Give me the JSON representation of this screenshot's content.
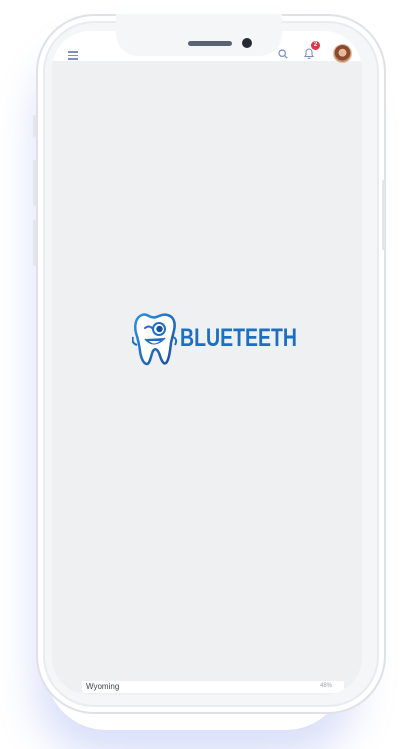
{
  "header": {
    "notification_count": "2"
  },
  "brand": {
    "name": "BLUETEETH",
    "color": "#1f6fc1"
  },
  "bottom_row": {
    "state": "Wyoming",
    "percent": "48%"
  },
  "icons": [
    "menu-icon",
    "search-icon",
    "bell-icon",
    "avatar",
    "tooth-mascot-icon"
  ]
}
